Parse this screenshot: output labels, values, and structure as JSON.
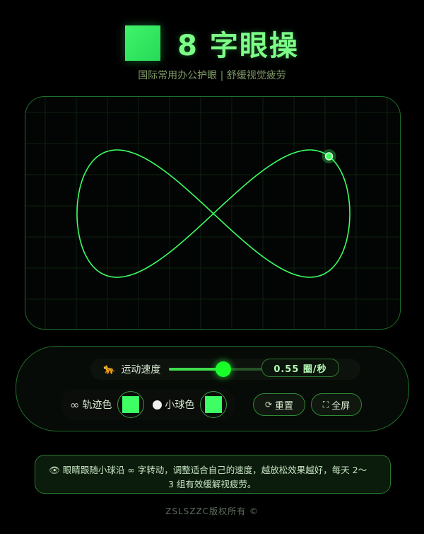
{
  "header": {
    "title": "8 字眼操",
    "subtitle": "国际常用办公护眼 | 舒缓视觉疲劳",
    "logo_color": "#3ff56a"
  },
  "canvas": {
    "grid": true,
    "trail_color": "#3dff63",
    "ball_color": "#3dff63",
    "ball_phase": 0.56
  },
  "controls": {
    "speed_label": "运动速度",
    "speed_icon": "leopard-icon",
    "speed_value": "0.55 圈/秒",
    "speed_level": 0.55,
    "trail_color_label": "轨迹色",
    "trail_color_icon": "infinity-icon",
    "trail_color_value": "#3dff63",
    "ball_color_label": "小球色",
    "ball_color_icon": "white-dot-icon",
    "ball_color_value": "#3dff63",
    "reset_label": "重置",
    "reset_icon": "refresh-icon",
    "fullscreen_label": "全屏",
    "fullscreen_icon": "fullscreen-icon"
  },
  "tip": {
    "line1": "👁 眼睛跟随小球沿 ∞ 字转动，调整适合自己的速度，越放松效果越好，每天 2～",
    "line2": "3 组有效缓解视疲劳。"
  },
  "footer": {
    "text": "ZSLSZZC版权所有 ©"
  }
}
